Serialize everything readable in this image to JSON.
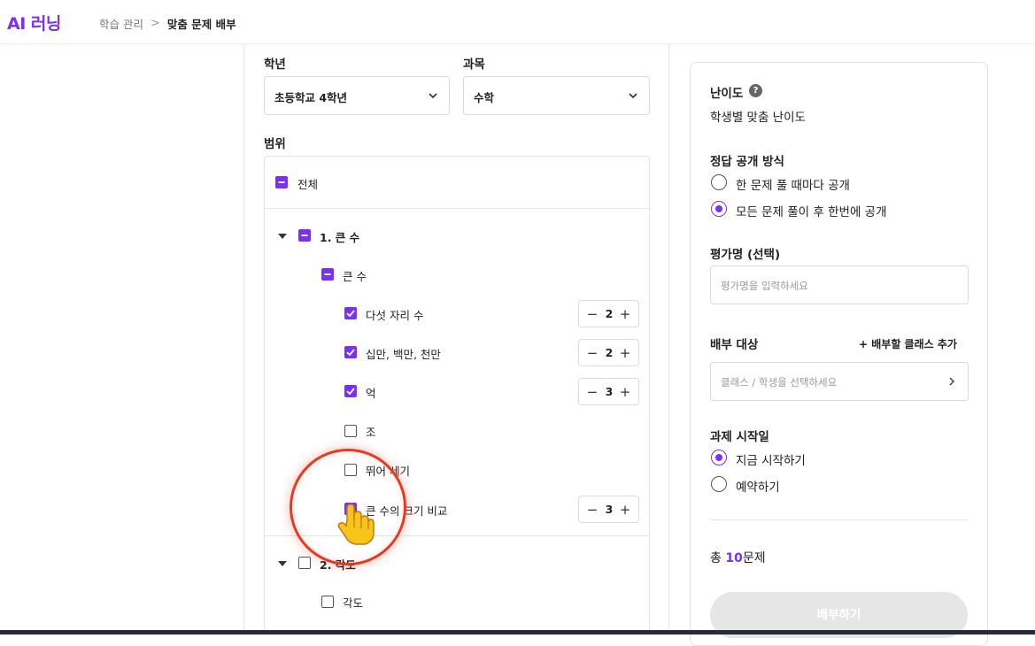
{
  "header": {
    "logo": "AI 러닝",
    "breadcrumb": [
      "학습 관리",
      "맞춤 문제 배부"
    ],
    "breadcrumb_sep": ">"
  },
  "form": {
    "grade_label": "학년",
    "grade_value": "초등학교 4학년",
    "subject_label": "과목",
    "subject_value": "수학",
    "scope_label": "범위"
  },
  "scope": {
    "all_label": "전체",
    "units": [
      {
        "title": "1. 큰 수",
        "sub": "큰 수",
        "items": [
          {
            "label": "다섯 자리 수",
            "checked": true,
            "count": "2"
          },
          {
            "label": "십만, 백만, 천만",
            "checked": true,
            "count": "2"
          },
          {
            "label": "억",
            "checked": true,
            "count": "3"
          },
          {
            "label": "조",
            "checked": false,
            "count": null
          },
          {
            "label": "뛰어 세기",
            "checked": false,
            "count": null
          },
          {
            "label": "큰 수의 크기 비교",
            "checked": true,
            "count": "3"
          }
        ]
      },
      {
        "title": "2. 각도",
        "sub": "각도"
      }
    ]
  },
  "settings": {
    "difficulty_label": "난이도",
    "difficulty_help": "?",
    "difficulty_value": "학생별 맞춤 난이도",
    "reveal_label": "정답 공개 방식",
    "reveal_options": [
      "한 문제 풀 때마다 공개",
      "모든 문제 풀이 후 한번에 공개"
    ],
    "reveal_selected": 1,
    "eval_label": "평가명 (선택)",
    "eval_placeholder": "평가명을 입력하세요",
    "target_label": "배부 대상",
    "add_class": "+ 배부할 클래스 추가",
    "target_placeholder": "클래스 / 학생을 선택하세요",
    "start_label": "과제 시작일",
    "start_options": [
      "지금 시작하기",
      "예약하기"
    ],
    "start_selected": 0,
    "total_prefix": "총 ",
    "total_count": "10",
    "total_suffix": "문제",
    "submit_label": "배부하기"
  },
  "colors": {
    "accent": "#7b2ff7",
    "cursor_ring": "#e8391f",
    "disabled_button": "#e6e6e6"
  }
}
